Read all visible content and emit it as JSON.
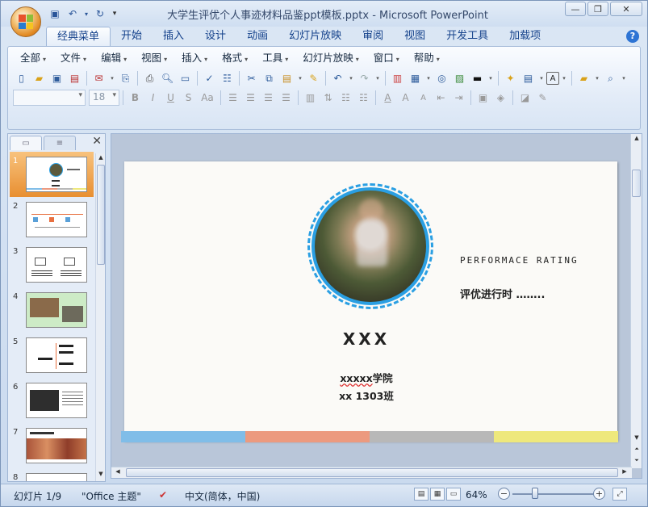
{
  "window": {
    "title": "大学生评优个人事迹材料品鉴ppt模板.pptx - Microsoft PowerPoint"
  },
  "ribbon_tabs": [
    "经典菜单",
    "开始",
    "插入",
    "设计",
    "动画",
    "幻灯片放映",
    "审阅",
    "视图",
    "开发工具",
    "加载项"
  ],
  "menu": [
    "全部",
    "文件",
    "编辑",
    "视图",
    "插入",
    "格式",
    "工具",
    "幻灯片放映",
    "窗口",
    "帮助"
  ],
  "format_bar": {
    "font_name": "",
    "font_size": "18"
  },
  "slides_pane": {
    "slide_numbers": [
      "1",
      "2",
      "3",
      "4",
      "5",
      "6",
      "7",
      "8"
    ],
    "selected": "1"
  },
  "slide": {
    "performance": "PERFORMACE RATING",
    "eval_text": "评优进行时   ……..",
    "name": "XXX",
    "college_u": "xxxxx",
    "college_rest": "学院",
    "class": "xx 1303班",
    "bar_colors": [
      "#80bde8",
      "#ec9a7f",
      "#b8b8b8",
      "#eee87c"
    ]
  },
  "status": {
    "slide_info": "幻灯片 1/9",
    "theme": "\"Office 主题\"",
    "language": "中文(简体，中国)",
    "zoom": "64%"
  },
  "colors": {
    "accent_blue": "#2a9fe3",
    "selected_thumb": "#e88f31"
  }
}
